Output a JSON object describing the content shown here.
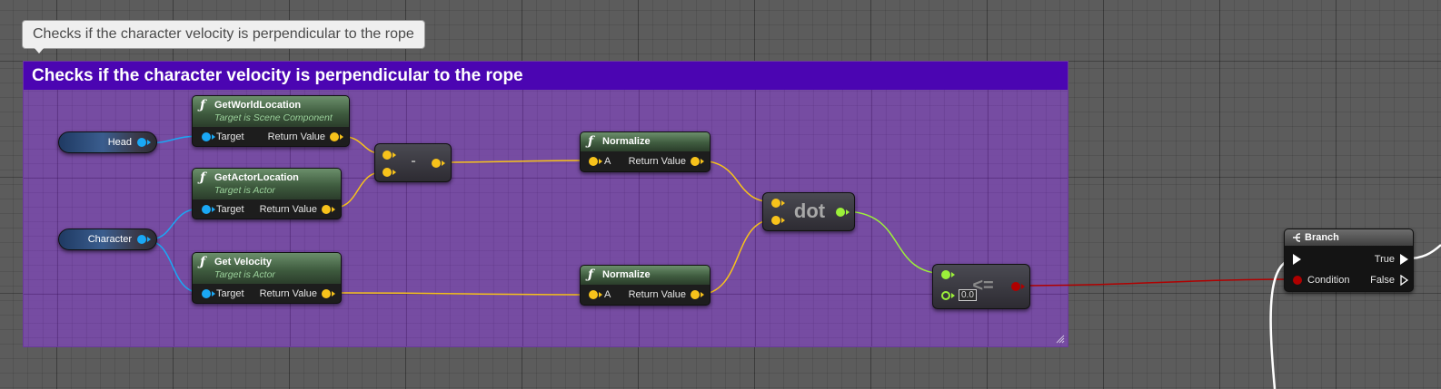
{
  "comment_bubble": "Checks if the character velocity is perpendicular to the rope",
  "comment_box": {
    "title": "Checks if the character velocity is perpendicular to the rope"
  },
  "colors": {
    "comment_header": "#4b05b2",
    "comment_body": "#794aaa",
    "object_pin": "#1aa8f5",
    "vector_pin": "#f7c21b",
    "float_pin": "#9cf03a",
    "bool_pin": "#b00000",
    "exec_pin": "#ffffff"
  },
  "variables": {
    "head": "Head",
    "character": "Character"
  },
  "functions": {
    "get_world_location": {
      "title": "GetWorldLocation",
      "subtitle": "Target is Scene Component",
      "in": "Target",
      "out": "Return Value"
    },
    "get_actor_location": {
      "title": "GetActorLocation",
      "subtitle": "Target is Actor",
      "in": "Target",
      "out": "Return Value"
    },
    "get_velocity": {
      "title": "Get Velocity",
      "subtitle": "Target is Actor",
      "in": "Target",
      "out": "Return Value"
    },
    "normalize_1": {
      "title": "Normalize",
      "in": "A",
      "out": "Return Value"
    },
    "normalize_2": {
      "title": "Normalize",
      "in": "A",
      "out": "Return Value"
    }
  },
  "operators": {
    "subtract": "-",
    "dot": "dot",
    "compare": "<=",
    "compare_default": "0.0"
  },
  "branch": {
    "title": "Branch",
    "condition": "Condition",
    "true_label": "True",
    "false_label": "False"
  },
  "icons": {
    "function": "function-icon",
    "branch": "branch-icon"
  }
}
